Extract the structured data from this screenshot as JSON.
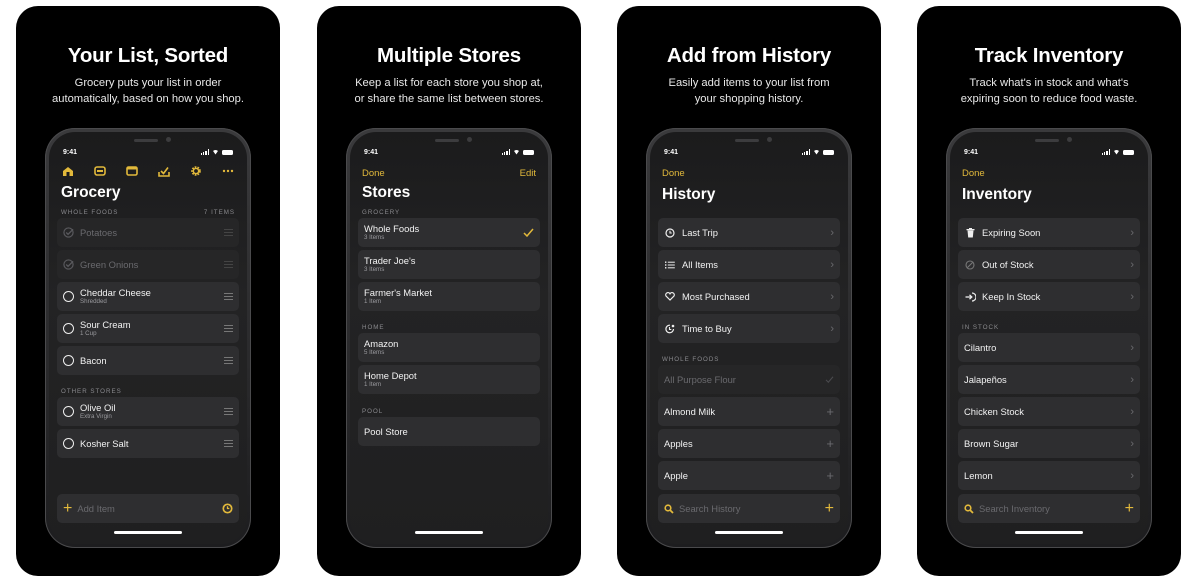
{
  "accent_color": "#e2b93b",
  "status_time": "9:41",
  "panels": [
    {
      "title": "Your List, Sorted",
      "subtitle_lines": [
        "Grocery puts your list in order",
        "automatically, based on how you shop."
      ],
      "screen": {
        "toolbar_icons": [
          "home-icon",
          "tray-icon",
          "window-icon",
          "checkbox-icon",
          "gear-icon",
          "more-icon"
        ],
        "title": "Grocery",
        "section1": {
          "label": "WHOLE FOODS",
          "count": "7 ITEMS"
        },
        "items": [
          {
            "name": "Potatoes",
            "detail": "",
            "done": true
          },
          {
            "name": "Green Onions",
            "detail": "",
            "done": true
          },
          {
            "name": "Cheddar Cheese",
            "detail": "Shredded",
            "done": false
          },
          {
            "name": "Sour Cream",
            "detail": "1 Cup",
            "done": false
          },
          {
            "name": "Bacon",
            "detail": "",
            "done": false
          }
        ],
        "section2": {
          "label": "OTHER STORES"
        },
        "other_items": [
          {
            "name": "Olive Oil",
            "detail": "Extra Virgin",
            "done": false
          },
          {
            "name": "Kosher Salt",
            "detail": "",
            "done": false
          }
        ],
        "add_placeholder": "Add Item"
      }
    },
    {
      "title": "Multiple Stores",
      "subtitle_lines": [
        "Keep a list for each store you shop at,",
        "or share the same list between stores."
      ],
      "screen": {
        "done_label": "Done",
        "edit_label": "Edit",
        "title": "Stores",
        "sections": [
          {
            "label": "GROCERY",
            "stores": [
              {
                "name": "Whole Foods",
                "detail": "3 Items",
                "selected": true
              },
              {
                "name": "Trader Joe's",
                "detail": "3 Items",
                "selected": false
              },
              {
                "name": "Farmer's Market",
                "detail": "1 Item",
                "selected": false
              }
            ]
          },
          {
            "label": "HOME",
            "stores": [
              {
                "name": "Amazon",
                "detail": "5 Items",
                "selected": false
              },
              {
                "name": "Home Depot",
                "detail": "1 Item",
                "selected": false
              }
            ]
          },
          {
            "label": "POOL",
            "stores": [
              {
                "name": "Pool Store",
                "detail": "",
                "selected": false
              }
            ]
          }
        ]
      }
    },
    {
      "title": "Add from History",
      "subtitle_lines": [
        "Easily add items to your list from",
        "your shopping history."
      ],
      "screen": {
        "done_label": "Done",
        "title": "History",
        "menu": [
          {
            "label": "Last Trip",
            "icon": "clock-icon"
          },
          {
            "label": "All Items",
            "icon": "list-icon"
          },
          {
            "label": "Most Purchased",
            "icon": "heart-icon"
          },
          {
            "label": "Time to Buy",
            "icon": "clock-badge-icon"
          }
        ],
        "section": "WHOLE FOODS",
        "items": [
          {
            "name": "All Purpose Flour",
            "added": true
          },
          {
            "name": "Almond Milk",
            "added": false
          },
          {
            "name": "Apples",
            "added": false
          },
          {
            "name": "Apple",
            "added": false
          }
        ],
        "search_placeholder": "Search History"
      }
    },
    {
      "title": "Track Inventory",
      "subtitle_lines": [
        "Track what's in stock and what's",
        "expiring soon to reduce food waste."
      ],
      "screen": {
        "done_label": "Done",
        "title": "Inventory",
        "menu": [
          {
            "label": "Expiring Soon",
            "icon": "trash-icon"
          },
          {
            "label": "Out of Stock",
            "icon": "slash-circle-icon"
          },
          {
            "label": "Keep In Stock",
            "icon": "arrow-in-icon"
          }
        ],
        "section": "IN STOCK",
        "items": [
          "Cilantro",
          "Jalapeños",
          "Chicken Stock",
          "Brown Sugar",
          "Lemon"
        ],
        "search_placeholder": "Search Inventory"
      }
    }
  ]
}
